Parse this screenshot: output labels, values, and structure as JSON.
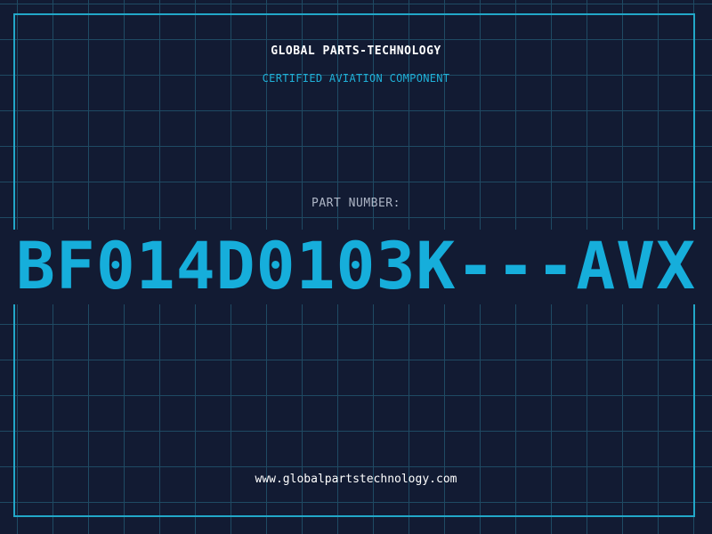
{
  "header": {
    "company": "GLOBAL PARTS-TECHNOLOGY",
    "tagline": "CERTIFIED AVIATION COMPONENT"
  },
  "part": {
    "label": "PART NUMBER:",
    "number": "BF014D0103K---AVX"
  },
  "footer": {
    "url": "www.globalpartstechnology.com"
  },
  "colors": {
    "background": "#121b33",
    "grid": "#1f4a63",
    "accent": "#16aedb",
    "text": "#ffffff"
  }
}
